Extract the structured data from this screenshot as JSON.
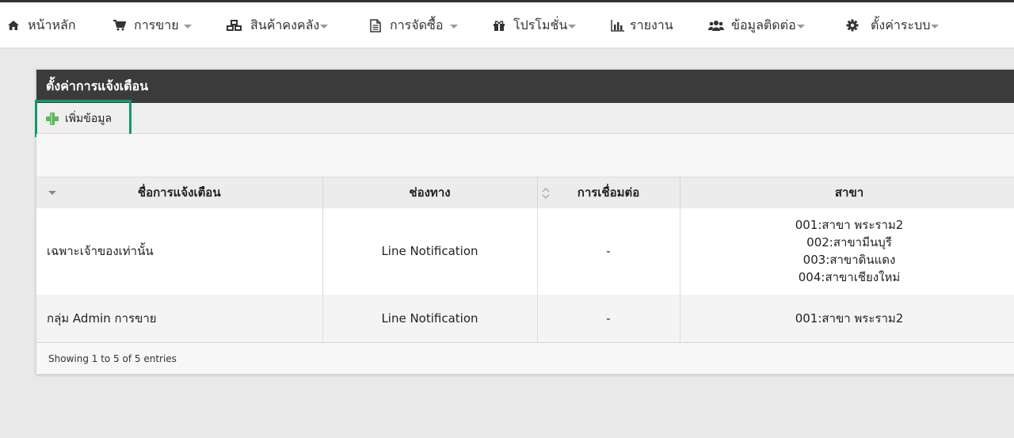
{
  "nav": {
    "items": [
      {
        "label": "หน้าหลัก",
        "icon": "home-icon",
        "dropdown": false
      },
      {
        "label": "การขาย",
        "icon": "cart-icon",
        "dropdown": true
      },
      {
        "label": "สินค้าคงคลัง",
        "icon": "cubes-icon",
        "dropdown": true
      },
      {
        "label": "การจัดซื้อ",
        "icon": "document-icon",
        "dropdown": true
      },
      {
        "label": "โปรโมชั่น",
        "icon": "gift-icon",
        "dropdown": true
      },
      {
        "label": "รายงาน",
        "icon": "bar-chart-icon",
        "dropdown": false
      },
      {
        "label": "ข้อมูลติดต่อ",
        "icon": "users-icon",
        "dropdown": true
      },
      {
        "label": "ตั้งค่าระบบ",
        "icon": "gear-icon",
        "dropdown": true
      }
    ]
  },
  "panel": {
    "title": "ตั้งค่าการแจ้งเตือน",
    "add_label": "เพิ่มข้อมูล"
  },
  "table": {
    "columns": [
      "ชื่อการแจ้งเตือน",
      "ช่องทาง",
      "การเชื่อมต่อ",
      "สาขา"
    ],
    "rows": [
      {
        "name": "เฉพาะเจ้าของเท่านั้น",
        "channel": "Line Notification",
        "connection": "-",
        "branches": [
          "001:สาขา พระราม2",
          "002:สาขามีนบุรี",
          "003:สาขาดินแดง",
          "004:สาขาเชียงใหม่"
        ]
      },
      {
        "name": "กลุ่ม Admin การขาย",
        "channel": "Line Notification",
        "connection": "-",
        "branches": [
          "001:สาขา พระราม2"
        ]
      }
    ],
    "info": "Showing 1 to 5 of 5 entries"
  },
  "colors": {
    "header_bg": "#3b3b3b",
    "highlight_border": "#119a6a",
    "plus_green": "#5cb85c"
  }
}
